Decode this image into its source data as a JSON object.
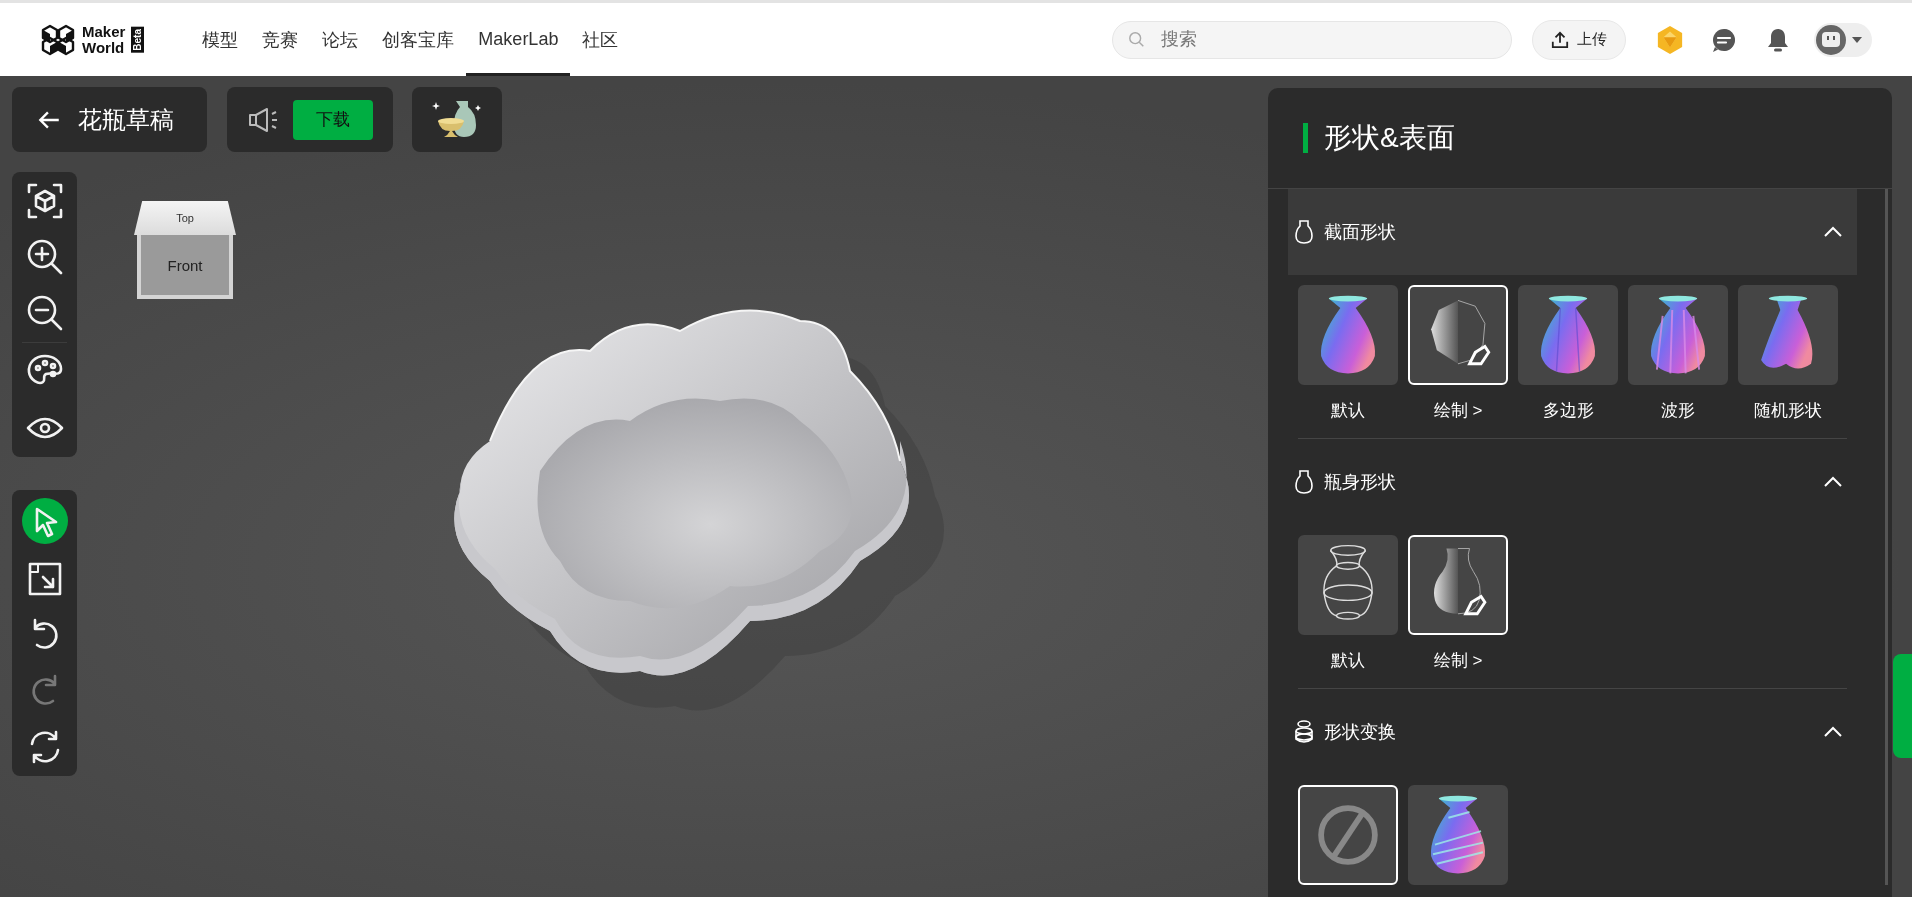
{
  "header": {
    "logo": {
      "line1": "Maker",
      "line2": "World",
      "badge": "Beta"
    },
    "nav": [
      {
        "label": "模型",
        "selected": false
      },
      {
        "label": "竞赛",
        "selected": false
      },
      {
        "label": "论坛",
        "selected": false
      },
      {
        "label": "创客宝库",
        "selected": false
      },
      {
        "label": "MakerLab",
        "selected": true
      },
      {
        "label": "社区",
        "selected": false
      }
    ],
    "search": {
      "placeholder": "搜索"
    },
    "upload": {
      "label": "上传"
    }
  },
  "project": {
    "title": "花瓶草稿",
    "download": "下载"
  },
  "view_cube": {
    "top": "Top",
    "front": "Front"
  },
  "toolbars": [
    {
      "tools": [
        {
          "kind": "fit",
          "selected": false,
          "disabled": false
        },
        {
          "kind": "zoom-in",
          "selected": false,
          "disabled": false
        },
        {
          "kind": "zoom-out",
          "selected": false,
          "disabled": false
        },
        {
          "kind": "palette",
          "selected": false,
          "disabled": false
        },
        {
          "kind": "eye",
          "selected": false,
          "disabled": false
        }
      ]
    },
    {
      "tools": [
        {
          "kind": "pointer",
          "selected": true,
          "disabled": false
        },
        {
          "kind": "scale",
          "selected": false,
          "disabled": false
        },
        {
          "kind": "undo",
          "selected": false,
          "disabled": false
        },
        {
          "kind": "redo",
          "selected": false,
          "disabled": true
        },
        {
          "kind": "reset",
          "selected": false,
          "disabled": false
        }
      ]
    }
  ],
  "panel": {
    "title": "形状&表面",
    "sections": [
      {
        "title": "截面形状",
        "highlighted": true,
        "expanded": true,
        "options": [
          {
            "label": "默认",
            "kind": "smooth",
            "selected": false
          },
          {
            "label": "绘制 >",
            "kind": "draw-section",
            "selected": true
          },
          {
            "label": "多边形",
            "kind": "polygon",
            "selected": false
          },
          {
            "label": "波形",
            "kind": "wave",
            "selected": false
          },
          {
            "label": "随机形状",
            "kind": "random",
            "selected": false
          }
        ]
      },
      {
        "title": "瓶身形状",
        "highlighted": false,
        "expanded": true,
        "options": [
          {
            "label": "默认",
            "kind": "wire",
            "selected": false
          },
          {
            "label": "绘制 >",
            "kind": "draw-body",
            "selected": true
          }
        ]
      },
      {
        "title": "形状变换",
        "highlighted": false,
        "expanded": true,
        "options": [
          {
            "kind": "none",
            "selected": true
          },
          {
            "kind": "twist",
            "selected": false
          }
        ]
      }
    ]
  }
}
